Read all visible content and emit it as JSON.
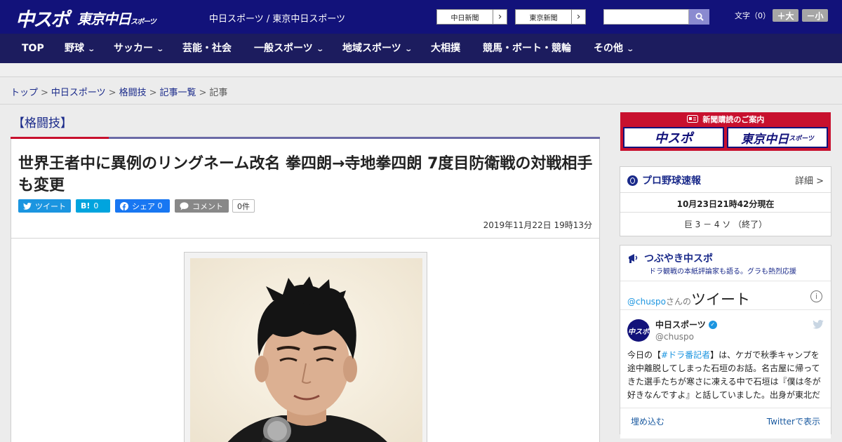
{
  "header": {
    "logo_chuspo": "中スポ",
    "logo_tokyo": "東京中日",
    "logo_tokyo_small": "スポーツ",
    "site_title": "中日スポーツ / 東京中日スポーツ",
    "btn_chunichi": "中日新聞",
    "btn_tokyo": "東京新聞",
    "search_placeholder": "",
    "font_label": "文字（0）",
    "font_bigger": "＋大",
    "font_smaller": "－小"
  },
  "nav": {
    "items": [
      {
        "label": "TOP"
      },
      {
        "label": "野球"
      },
      {
        "label": "サッカー"
      },
      {
        "label": "芸能・社会"
      },
      {
        "label": "一般スポーツ"
      },
      {
        "label": "地域スポーツ"
      },
      {
        "label": "大相撲"
      },
      {
        "label": "競馬・ボート・競輪"
      },
      {
        "label": "その他"
      }
    ]
  },
  "breadcrumb": {
    "items": [
      "トップ",
      "中日スポーツ",
      "格闘技",
      "記事一覧"
    ],
    "current": "記事"
  },
  "article": {
    "category": "【格闘技】",
    "headline": "世界王者中に異例のリングネーム改名 拳四朗→寺地拳四朗 7度目防衛戦の対戦相手も変更",
    "share": {
      "tweet": "ツイート",
      "hatena_icon": "B!",
      "hatena_count": "0",
      "facebook": "シェア",
      "facebook_count": "0",
      "comment": "コメント",
      "comment_count": "0件"
    },
    "date": "2019年11月22日 19時13分"
  },
  "sidebar": {
    "subscribe_title": "新聞購読のご案内",
    "sub_logo_1": "中スポ",
    "sub_logo_2": "東京中日",
    "sub_logo_2_small": "スポーツ",
    "baseball": {
      "title": "プロ野球速報",
      "more": "詳細 >",
      "time": "10月23日21時42分現在",
      "score": "巨 3 － 4 ソ （終了）"
    },
    "twitter_widget": {
      "title": "つぶやき中スポ",
      "subtitle": "ドラ観戦の本紙評論家も語る。グラも熱烈応援",
      "handle": "@chuspo",
      "handle_suffix": "さんの",
      "tweets_label": "ツイート",
      "info": "i",
      "account_name": "中日スポーツ",
      "account_user": "@chuspo",
      "avatar_text": "中スポ",
      "tweet_pre": "今日の【",
      "tweet_tag": "#ドラ番記者",
      "tweet_post": "】は、ケガで秋季キャンプを途中離脱してしまった石垣のお話。名古屋に帰ってきた選手たちが寒さに凍える中で石垣は『僕は冬が好きなんですよ』と話していました。出身が東北だ",
      "embed": "埋め込む",
      "view_on_twitter": "Twitterで表示"
    }
  },
  "colors": {
    "header_bg": "#12127a",
    "nav_bg": "#1c1c5e",
    "accent_red": "#c8102e",
    "twitter_blue": "#1b95e0",
    "hatena_blue": "#00a4de",
    "facebook_blue": "#1877f2",
    "comment_gray": "#888888"
  }
}
